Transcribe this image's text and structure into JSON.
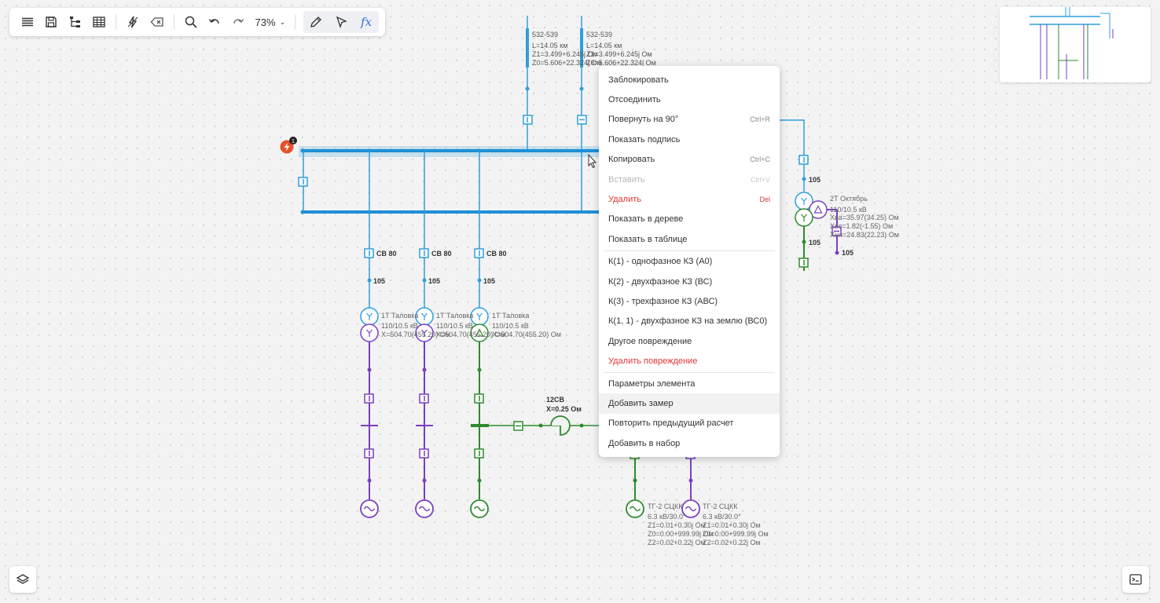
{
  "toolbar": {
    "zoom": "73%",
    "zoom_chevron": "⌄"
  },
  "diagram": {
    "fault_badge": "1",
    "lines": [
      {
        "name": "532-539",
        "length": "L=14.05 км",
        "z1": "Z1=3.499+6.245j Ом",
        "z0": "Z0=5.606+22.324j Ом"
      },
      {
        "name": "532-539",
        "length": "L=14.05 км",
        "z1": "Z1=3.499+6.245j Ом",
        "z0": "Z0=5.606+22.324j Ом"
      }
    ],
    "breaker_labels": [
      "CB 80",
      "CB 80",
      "CB 80"
    ],
    "node_labels": [
      "105",
      "105",
      "105",
      "105",
      "105",
      "105"
    ],
    "transformers": [
      {
        "name": "1Т Таловка",
        "voltage": "110/10.5 кВ",
        "x": "X=504.70(455.20) Ом"
      },
      {
        "name": "1Т Таловка",
        "voltage": "110/10.5 кВ",
        "x": "X=504.70(455.20) Ом"
      },
      {
        "name": "1Т Таловка",
        "voltage": "110/10.5 кВ",
        "x": "X=504.70(455.20) Ом"
      }
    ],
    "transformer2": {
      "name": "2Т Октябрь",
      "voltage": "110/10.5 кВ",
      "x1": "Xва=35.97(34.25) Ом",
      "x2": "Xвс=1.82(-1.55) Ом",
      "x3": "Xнн=24.83(22.23) Ом"
    },
    "reactor": {
      "name": "12CB",
      "x": "X=0.25 Ом"
    },
    "generators": [
      {
        "name": "ТГ-2 СЦКК",
        "rating": "6.3 кВ/30.0°",
        "z1": "Z1=0.01+0.30j Ом",
        "z0": "Z0=0.00+999.99j Ом",
        "z2": "Z2=0.02+0.22j Ом"
      },
      {
        "name": "ТГ-2 СЦКК",
        "rating": "6.3 кВ/30.0°",
        "z1": "Z1=0.01+0.30j Ом",
        "z0": "Z0=0.00+999.99j Ом",
        "z2": "Z2=0.02+0.22j Ом"
      }
    ]
  },
  "context_menu": [
    {
      "label": "Заблокировать",
      "shortcut": "",
      "state": "normal"
    },
    {
      "label": "Отсоединить",
      "shortcut": "",
      "state": "normal"
    },
    {
      "label": "Повернуть на 90°",
      "shortcut": "Ctrl+R",
      "state": "normal"
    },
    {
      "label": "Показать подпись",
      "shortcut": "",
      "state": "normal"
    },
    {
      "label": "Копировать",
      "shortcut": "Ctrl+C",
      "state": "normal"
    },
    {
      "label": "Вставить",
      "shortcut": "Ctrl+V",
      "state": "disabled"
    },
    {
      "label": "Удалить",
      "shortcut": "Del",
      "state": "danger"
    },
    {
      "label": "Показать в дереве",
      "shortcut": "",
      "state": "normal"
    },
    {
      "label": "Показать в таблице",
      "shortcut": "",
      "state": "normal"
    },
    {
      "label": "К(1) - однофазное КЗ (А0)",
      "shortcut": "",
      "state": "normal"
    },
    {
      "label": "К(2) - двухфазное КЗ (ВС)",
      "shortcut": "",
      "state": "normal"
    },
    {
      "label": "К(3) - трехфазное КЗ (АВС)",
      "shortcut": "",
      "state": "normal"
    },
    {
      "label": "К(1, 1) - двухфазное КЗ на землю (ВС0)",
      "shortcut": "",
      "state": "normal"
    },
    {
      "label": "Другое повреждение",
      "shortcut": "",
      "state": "normal"
    },
    {
      "label": "Удалить повреждение",
      "shortcut": "",
      "state": "danger"
    },
    {
      "label": "Параметры элемента",
      "shortcut": "",
      "state": "normal"
    },
    {
      "label": "Добавить замер",
      "shortcut": "",
      "state": "highlighted"
    },
    {
      "label": "Повторить предыдущий расчет",
      "shortcut": "",
      "state": "normal"
    },
    {
      "label": "Добавить в набор",
      "shortcut": "",
      "state": "normal"
    }
  ],
  "colors": {
    "blue": "#2f9fdc",
    "purple": "#7a3fc0",
    "green": "#2e8b2e",
    "danger": "#e03535",
    "fault": "#e8502a"
  }
}
